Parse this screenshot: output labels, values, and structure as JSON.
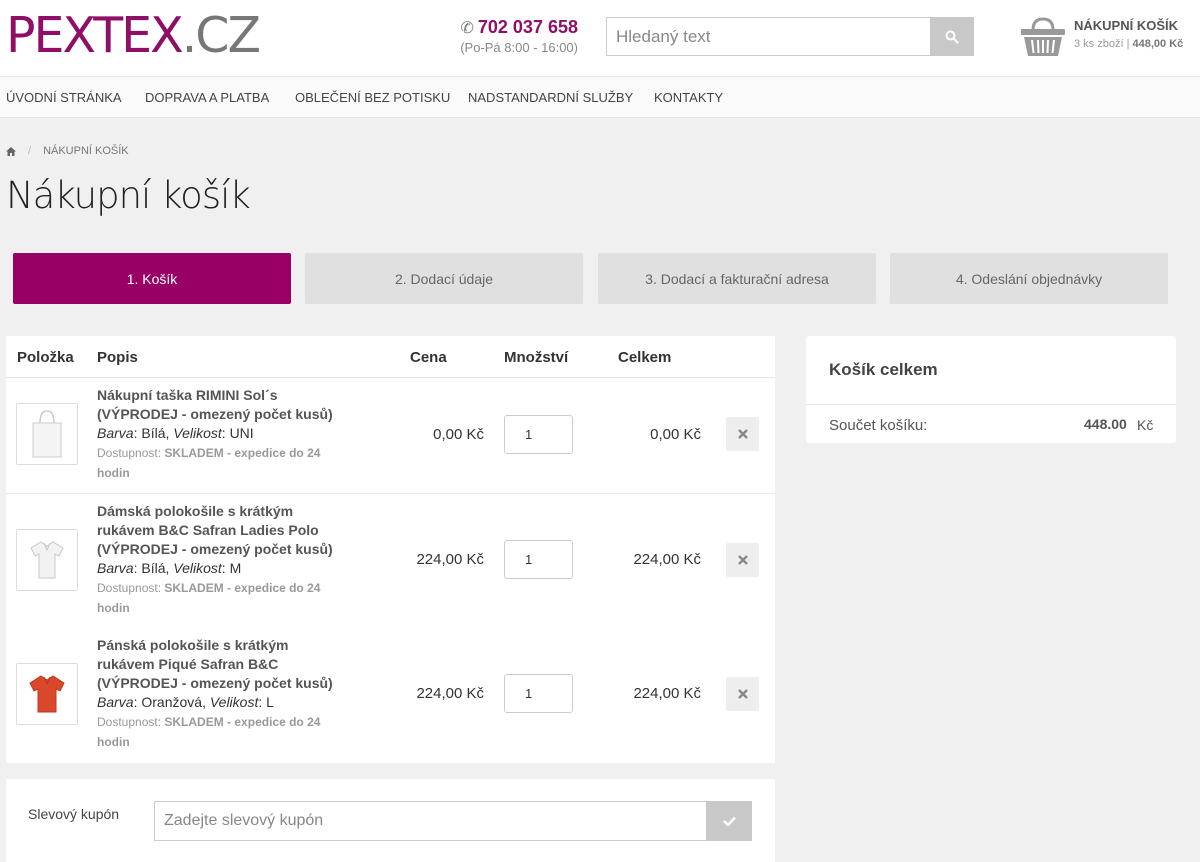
{
  "header": {
    "logo_main": "PEXTEX",
    "logo_suffix": ".CZ",
    "phone": "702 037 658",
    "hours": "(Po-Pá 8:00 - 16:00)",
    "search_placeholder": "Hledaný text",
    "cart_title": "NÁKUPNÍ KOŠÍK",
    "cart_count": "3 ks zboží",
    "cart_total": "448,00 Kč"
  },
  "nav": {
    "items": [
      {
        "label": "ÚVODNÍ STRÁNKA"
      },
      {
        "label": "DOPRAVA A PLATBA"
      },
      {
        "label": "OBLEČENÍ BEZ POTISKU"
      },
      {
        "label": "NADSTANDARDNÍ SLUŽBY"
      },
      {
        "label": "KONTAKTY"
      }
    ]
  },
  "breadcrumb": {
    "current": "NÁKUPNÍ KOŠÍK"
  },
  "page_title": "Nákupní košík",
  "steps": [
    {
      "label": "1. Košík",
      "active": true
    },
    {
      "label": "2. Dodací údaje",
      "active": false
    },
    {
      "label": "3. Dodací a fakturační adresa",
      "active": false
    },
    {
      "label": "4. Odeslání objednávky",
      "active": false
    }
  ],
  "table": {
    "headers": {
      "item": "Položka",
      "description": "Popis",
      "price": "Cena",
      "quantity": "Množství",
      "total": "Celkem"
    },
    "rows": [
      {
        "name_l1": "Nákupní taška RIMINI Sol´s",
        "name_l2": "(VÝPRODEJ - omezený počet kusů)",
        "color_label": "Barva",
        "color": "Bílá",
        "size_label": "Velikost",
        "size": "UNI",
        "avail_label": "Dostupnost:",
        "avail_l1": "SKLADEM - expedice do 24",
        "avail_l2": "hodin",
        "price": "0,00 Kč",
        "qty": "1",
        "total": "0,00 Kč"
      },
      {
        "name_l1": "Dámská polokošile s krátkým",
        "name_l2": "rukávem B&C Safran Ladies Polo",
        "name_l3": "(VÝPRODEJ - omezený počet kusů)",
        "color_label": "Barva",
        "color": "Bílá",
        "size_label": "Velikost",
        "size": "M",
        "avail_label": "Dostupnost:",
        "avail_l1": "SKLADEM - expedice do 24",
        "avail_l2": "hodin",
        "price": "224,00 Kč",
        "qty": "1",
        "total": "224,00 Kč"
      },
      {
        "name_l1": "Pánská polokošile s krátkým",
        "name_l2": "rukávem Piqué Safran B&C",
        "name_l3": "(VÝPRODEJ - omezený počet kusů)",
        "color_label": "Barva",
        "color": "Oranžová",
        "size_label": "Velikost",
        "size": "L",
        "avail_label": "Dostupnost:",
        "avail_l1": "SKLADEM - expedice do 24",
        "avail_l2": "hodin",
        "price": "224,00 Kč",
        "qty": "1",
        "total": "224,00 Kč"
      }
    ]
  },
  "summary": {
    "title": "Košík celkem",
    "sum_label": "Součet košíku:",
    "sum_value": "448.00",
    "currency": "Kč"
  },
  "coupon": {
    "label": "Slevový kupón",
    "placeholder": "Zadejte slevový kupón"
  },
  "colors": {
    "brand": "#8e0f65",
    "step_active": "#990066",
    "step_inactive": "#e0e0e0"
  },
  "icons": [
    "phone-icon",
    "search-icon",
    "basket-icon",
    "home-icon",
    "remove-icon",
    "check-icon"
  ]
}
